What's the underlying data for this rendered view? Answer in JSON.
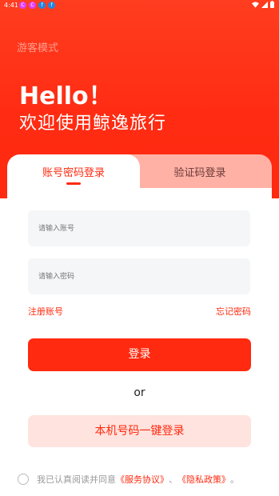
{
  "status": {
    "time": "4:41",
    "app_icons": [
      "C",
      "C",
      "f",
      "f"
    ]
  },
  "header": {
    "guest_mode": "游客模式",
    "hello": "Hello！",
    "subtitle": "欢迎使用鲸逸旅行"
  },
  "tabs": {
    "password_login": "账号密码登录",
    "code_login": "验证码登录"
  },
  "form": {
    "account_placeholder": "请输入账号",
    "password_placeholder": "请输入密码",
    "register": "注册账号",
    "forgot": "忘记密码",
    "login_button": "登录",
    "or": "or",
    "quick_login": "本机号码一键登录"
  },
  "agreement": {
    "prefix": "我已认真阅读并同意",
    "service": "《服务协议》",
    "sep": "、",
    "privacy": "《隐私政策》",
    "end": "。"
  },
  "colors": {
    "accent": "#ff2a0f",
    "tab_inactive": "#ffb1a6",
    "quick_bg": "#ffe3de"
  }
}
